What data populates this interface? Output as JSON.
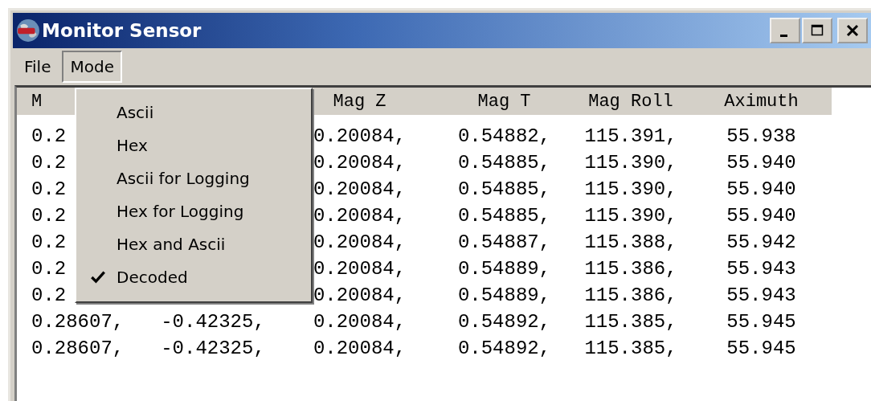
{
  "window": {
    "title": "Monitor Sensor"
  },
  "menu_bar": [
    {
      "label": "File",
      "selected": false
    },
    {
      "label": "Mode",
      "selected": true
    }
  ],
  "table": {
    "columns": [
      "M",
      null,
      "Mag Z",
      "Mag T",
      "Mag Roll",
      "Aximuth"
    ],
    "rows": [
      {
        "cells": [
          "0.2",
          null,
          "0.20084,",
          "0.54882,",
          "115.391,",
          "55.938"
        ]
      },
      {
        "cells": [
          "0.2",
          null,
          "0.20084,",
          "0.54885,",
          "115.390,",
          "55.940"
        ]
      },
      {
        "cells": [
          "0.2",
          null,
          "0.20084,",
          "0.54885,",
          "115.390,",
          "55.940"
        ]
      },
      {
        "cells": [
          "0.2",
          null,
          "0.20084,",
          "0.54885,",
          "115.390,",
          "55.940"
        ]
      },
      {
        "cells": [
          "0.2",
          null,
          "0.20084,",
          "0.54887,",
          "115.388,",
          "55.942"
        ]
      },
      {
        "cells": [
          "0.2",
          null,
          "0.20084,",
          "0.54889,",
          "115.386,",
          "55.943"
        ]
      },
      {
        "cells": [
          "0.2",
          null,
          "0.20084,",
          "0.54889,",
          "115.386,",
          "55.943"
        ]
      },
      {
        "cells": [
          "0.28607,",
          "-0.42325,",
          "0.20084,",
          "0.54892,",
          "115.385,",
          "55.945"
        ]
      },
      {
        "cells": [
          "0.28607,",
          "-0.42325,",
          "0.20084,",
          "0.54892,",
          "115.385,",
          "55.945"
        ]
      }
    ]
  },
  "dropdown": {
    "items": [
      {
        "label": "Ascii",
        "checked": false
      },
      {
        "label": "Hex",
        "checked": false
      },
      {
        "label": "Ascii for Logging",
        "checked": false
      },
      {
        "label": "Hex for Logging",
        "checked": false
      },
      {
        "label": "Hex and Ascii",
        "checked": false
      },
      {
        "label": "Decoded",
        "checked": true
      }
    ]
  }
}
